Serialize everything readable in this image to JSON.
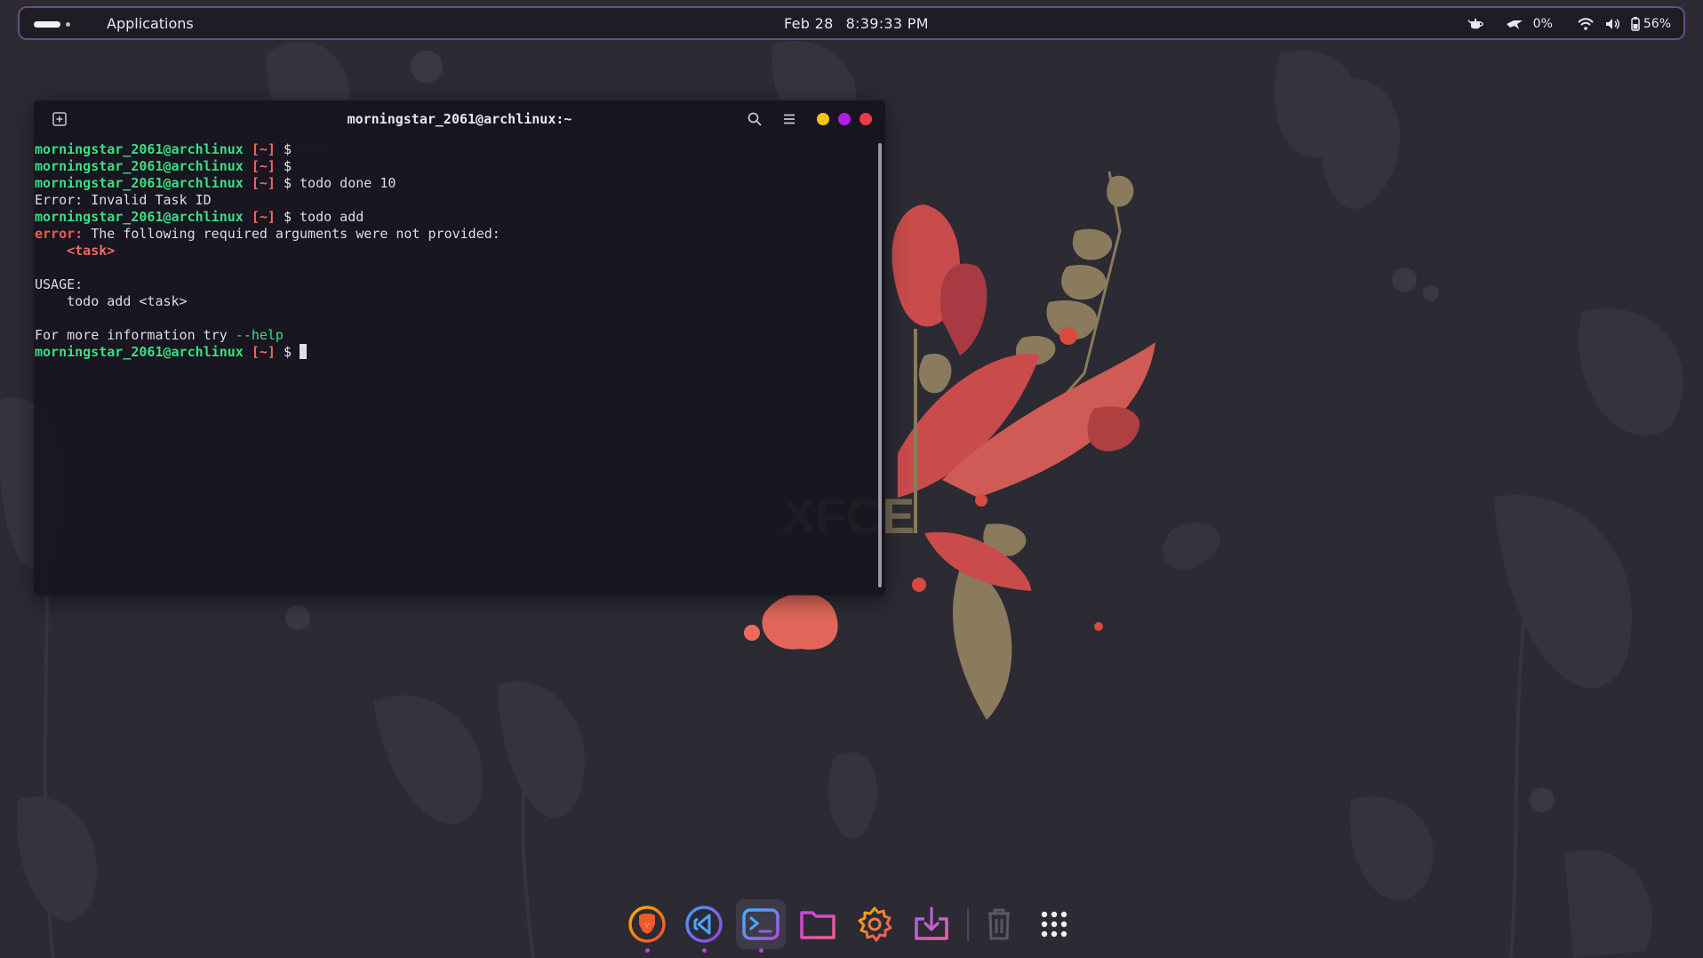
{
  "panel": {
    "applications_label": "Applications",
    "date": "Feb 28",
    "time": "8:39:33 PM",
    "tray": {
      "cpu_icon": "teapot-icon",
      "net_icon": "network-speed-icon",
      "cpu_percent": "0%",
      "wifi_icon": "wifi-icon",
      "volume_icon": "volume-icon",
      "battery_icon": "battery-icon",
      "battery_percent": "56%"
    }
  },
  "terminal": {
    "title": "morningstar_2061@archlinux:~",
    "prompt_user": "morningstar_2061@archlinux",
    "prompt_dir": "[~]",
    "prompt_sign": "$",
    "lines": [
      {
        "cmd": ""
      },
      {
        "cmd": ""
      },
      {
        "cmd": "todo done 10"
      },
      {
        "out": "Error: Invalid Task ID"
      },
      {
        "cmd": "todo add"
      },
      {
        "err_label": "error:",
        "err_text": " The following required arguments were not provided:"
      },
      {
        "arg": "<task>"
      },
      {
        "out": ""
      },
      {
        "out": "USAGE:"
      },
      {
        "out": "    todo add <task>"
      },
      {
        "out": ""
      },
      {
        "help_prefix": "For more information try ",
        "help_flag": "--help"
      },
      {
        "cmd": "",
        "cursor": true
      }
    ]
  },
  "dock": {
    "items": [
      {
        "name": "brave-browser",
        "icon": "brave-lion-icon",
        "running": true
      },
      {
        "name": "vscode",
        "icon": "vscode-icon",
        "running": true
      },
      {
        "name": "terminal",
        "icon": "terminal-icon",
        "running": true,
        "active": true
      },
      {
        "name": "files",
        "icon": "folder-icon"
      },
      {
        "name": "settings",
        "icon": "gear-icon"
      },
      {
        "name": "software-install",
        "icon": "download-box-icon"
      },
      {
        "name": "trash",
        "icon": "trash-icon"
      },
      {
        "name": "app-grid",
        "icon": "app-grid-icon"
      }
    ]
  },
  "colors": {
    "desktop_bg": "#2c2a33",
    "panel_border": "#6a4a86",
    "prompt_user": "#3ddc84",
    "prompt_dir": "#f06a5c",
    "error": "#f05a50",
    "btn_min": "#f5c518",
    "btn_max": "#b31ee6",
    "btn_close": "#f03a4a"
  }
}
